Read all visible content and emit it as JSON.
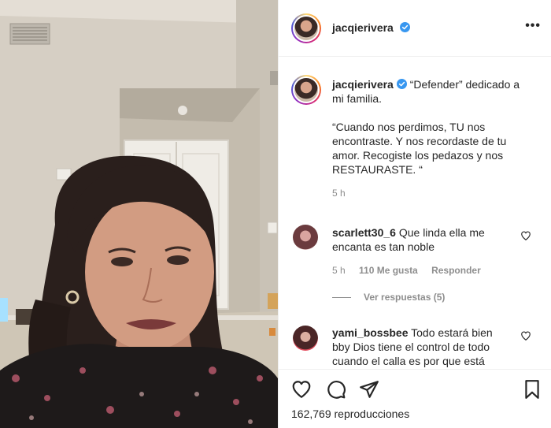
{
  "post": {
    "username": "jacqierivera",
    "more_label": "•••"
  },
  "caption": {
    "username": "jacqierivera",
    "line1": "“Defender” dedicado a",
    "line2": "mi familia.",
    "quote": [
      "“Cuando nos perdimos, TU nos",
      "encontraste. Y nos recordaste de tu",
      "amor. Recogiste los pedazos y nos",
      "RESTAURASTE. “"
    ],
    "time": "5 h"
  },
  "comments": [
    {
      "username": "scarlett30_6",
      "text_line1": "Que linda ella me",
      "text_line2": "encanta es tan noble",
      "time": "5 h",
      "likes": "110 Me gusta",
      "reply": "Responder",
      "view_replies": "Ver respuestas (5)"
    },
    {
      "username": "yami_bossbee",
      "text_line1": "Todo estará bien",
      "text_line2": "bby Dios tiene el control de todo",
      "text_line3": "cuando el calla es por que está"
    }
  ],
  "footer": {
    "views": "162,769 reproducciones"
  },
  "icons": {
    "verified": "verified-badge-icon",
    "like": "heart-icon",
    "comment": "comment-icon",
    "share": "paper-plane-icon",
    "save": "bookmark-icon"
  },
  "colors": {
    "verified_blue": "#3897f0",
    "meta_gray": "#8e8e8e",
    "text": "#262626"
  }
}
